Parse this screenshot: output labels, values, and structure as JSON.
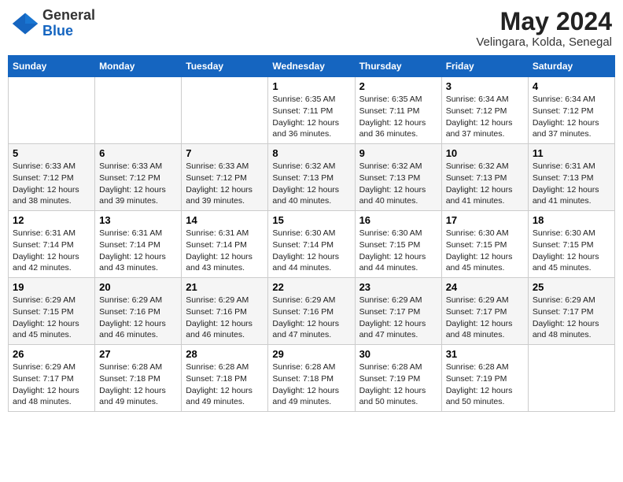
{
  "header": {
    "logo_general": "General",
    "logo_blue": "Blue",
    "month_year": "May 2024",
    "location": "Velingara, Kolda, Senegal"
  },
  "weekdays": [
    "Sunday",
    "Monday",
    "Tuesday",
    "Wednesday",
    "Thursday",
    "Friday",
    "Saturday"
  ],
  "weeks": [
    [
      {
        "day": "",
        "info": ""
      },
      {
        "day": "",
        "info": ""
      },
      {
        "day": "",
        "info": ""
      },
      {
        "day": "1",
        "info": "Sunrise: 6:35 AM\nSunset: 7:11 PM\nDaylight: 12 hours\nand 36 minutes."
      },
      {
        "day": "2",
        "info": "Sunrise: 6:35 AM\nSunset: 7:11 PM\nDaylight: 12 hours\nand 36 minutes."
      },
      {
        "day": "3",
        "info": "Sunrise: 6:34 AM\nSunset: 7:12 PM\nDaylight: 12 hours\nand 37 minutes."
      },
      {
        "day": "4",
        "info": "Sunrise: 6:34 AM\nSunset: 7:12 PM\nDaylight: 12 hours\nand 37 minutes."
      }
    ],
    [
      {
        "day": "5",
        "info": "Sunrise: 6:33 AM\nSunset: 7:12 PM\nDaylight: 12 hours\nand 38 minutes."
      },
      {
        "day": "6",
        "info": "Sunrise: 6:33 AM\nSunset: 7:12 PM\nDaylight: 12 hours\nand 39 minutes."
      },
      {
        "day": "7",
        "info": "Sunrise: 6:33 AM\nSunset: 7:12 PM\nDaylight: 12 hours\nand 39 minutes."
      },
      {
        "day": "8",
        "info": "Sunrise: 6:32 AM\nSunset: 7:13 PM\nDaylight: 12 hours\nand 40 minutes."
      },
      {
        "day": "9",
        "info": "Sunrise: 6:32 AM\nSunset: 7:13 PM\nDaylight: 12 hours\nand 40 minutes."
      },
      {
        "day": "10",
        "info": "Sunrise: 6:32 AM\nSunset: 7:13 PM\nDaylight: 12 hours\nand 41 minutes."
      },
      {
        "day": "11",
        "info": "Sunrise: 6:31 AM\nSunset: 7:13 PM\nDaylight: 12 hours\nand 41 minutes."
      }
    ],
    [
      {
        "day": "12",
        "info": "Sunrise: 6:31 AM\nSunset: 7:14 PM\nDaylight: 12 hours\nand 42 minutes."
      },
      {
        "day": "13",
        "info": "Sunrise: 6:31 AM\nSunset: 7:14 PM\nDaylight: 12 hours\nand 43 minutes."
      },
      {
        "day": "14",
        "info": "Sunrise: 6:31 AM\nSunset: 7:14 PM\nDaylight: 12 hours\nand 43 minutes."
      },
      {
        "day": "15",
        "info": "Sunrise: 6:30 AM\nSunset: 7:14 PM\nDaylight: 12 hours\nand 44 minutes."
      },
      {
        "day": "16",
        "info": "Sunrise: 6:30 AM\nSunset: 7:15 PM\nDaylight: 12 hours\nand 44 minutes."
      },
      {
        "day": "17",
        "info": "Sunrise: 6:30 AM\nSunset: 7:15 PM\nDaylight: 12 hours\nand 45 minutes."
      },
      {
        "day": "18",
        "info": "Sunrise: 6:30 AM\nSunset: 7:15 PM\nDaylight: 12 hours\nand 45 minutes."
      }
    ],
    [
      {
        "day": "19",
        "info": "Sunrise: 6:29 AM\nSunset: 7:15 PM\nDaylight: 12 hours\nand 45 minutes."
      },
      {
        "day": "20",
        "info": "Sunrise: 6:29 AM\nSunset: 7:16 PM\nDaylight: 12 hours\nand 46 minutes."
      },
      {
        "day": "21",
        "info": "Sunrise: 6:29 AM\nSunset: 7:16 PM\nDaylight: 12 hours\nand 46 minutes."
      },
      {
        "day": "22",
        "info": "Sunrise: 6:29 AM\nSunset: 7:16 PM\nDaylight: 12 hours\nand 47 minutes."
      },
      {
        "day": "23",
        "info": "Sunrise: 6:29 AM\nSunset: 7:17 PM\nDaylight: 12 hours\nand 47 minutes."
      },
      {
        "day": "24",
        "info": "Sunrise: 6:29 AM\nSunset: 7:17 PM\nDaylight: 12 hours\nand 48 minutes."
      },
      {
        "day": "25",
        "info": "Sunrise: 6:29 AM\nSunset: 7:17 PM\nDaylight: 12 hours\nand 48 minutes."
      }
    ],
    [
      {
        "day": "26",
        "info": "Sunrise: 6:29 AM\nSunset: 7:17 PM\nDaylight: 12 hours\nand 48 minutes."
      },
      {
        "day": "27",
        "info": "Sunrise: 6:28 AM\nSunset: 7:18 PM\nDaylight: 12 hours\nand 49 minutes."
      },
      {
        "day": "28",
        "info": "Sunrise: 6:28 AM\nSunset: 7:18 PM\nDaylight: 12 hours\nand 49 minutes."
      },
      {
        "day": "29",
        "info": "Sunrise: 6:28 AM\nSunset: 7:18 PM\nDaylight: 12 hours\nand 49 minutes."
      },
      {
        "day": "30",
        "info": "Sunrise: 6:28 AM\nSunset: 7:19 PM\nDaylight: 12 hours\nand 50 minutes."
      },
      {
        "day": "31",
        "info": "Sunrise: 6:28 AM\nSunset: 7:19 PM\nDaylight: 12 hours\nand 50 minutes."
      },
      {
        "day": "",
        "info": ""
      }
    ]
  ]
}
